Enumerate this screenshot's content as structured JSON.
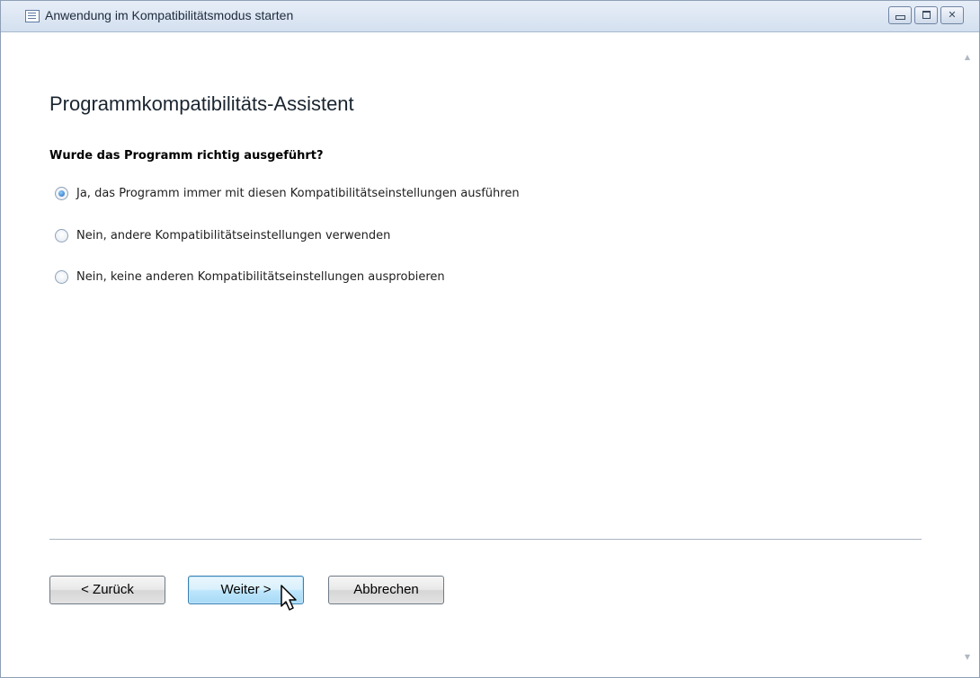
{
  "window": {
    "title": "Anwendung im Kompatibilitätsmodus starten",
    "controls": {
      "minimize": "minimize-icon",
      "maximize": "maximize-icon",
      "close": "close-icon"
    }
  },
  "wizard": {
    "heading": "Programmkompatibilitäts-Assistent",
    "question": "Wurde das Programm richtig ausgeführt?",
    "options": [
      {
        "label": "Ja, das Programm immer mit diesen Kompatibilitätseinstellungen ausführen",
        "selected": true
      },
      {
        "label": "Nein, andere Kompatibilitätseinstellungen verwenden",
        "selected": false
      },
      {
        "label": "Nein, keine anderen Kompatibilitätseinstellungen ausprobieren",
        "selected": false
      }
    ]
  },
  "buttons": {
    "back": "< Zurück",
    "next": "Weiter >",
    "cancel": "Abbrechen"
  },
  "colors": {
    "accent": "#1e62b8",
    "titlebar": "#d4e0ef",
    "default_button": "#bee6fd"
  }
}
